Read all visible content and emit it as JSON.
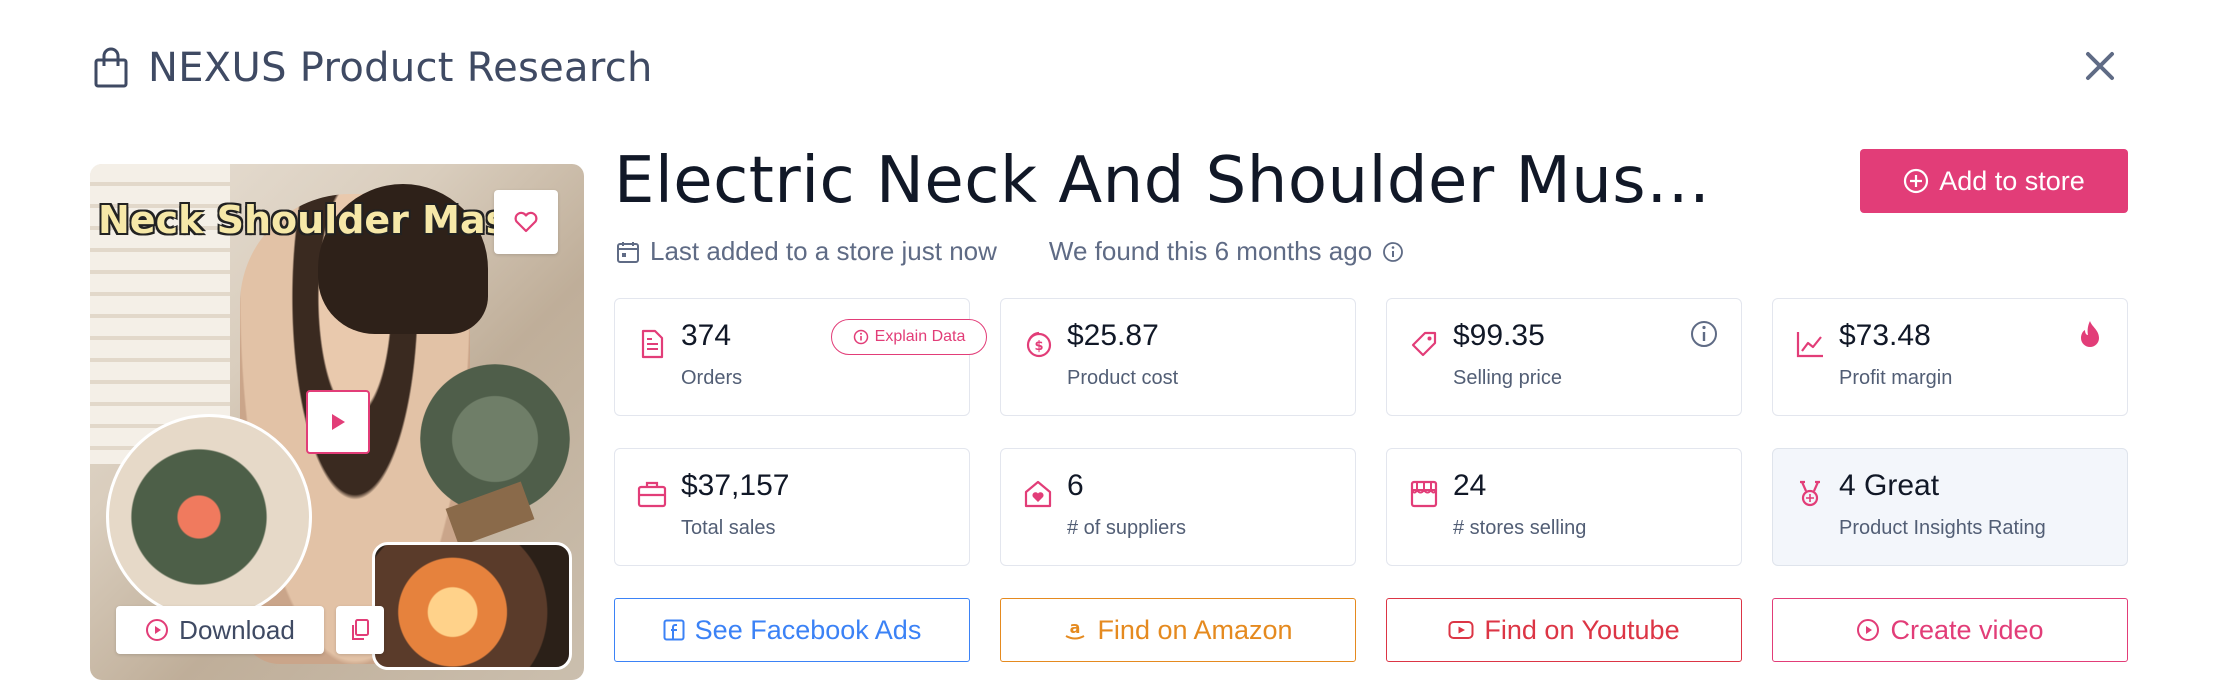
{
  "header": {
    "title": "NEXUS Product Research"
  },
  "image": {
    "banner_text": "Neck Shoulder Massa",
    "download_label": "Download"
  },
  "product": {
    "title": "Electric Neck And Shoulder Muscle M…",
    "last_added": "Last added to a store just now",
    "found": "We found this 6 months ago"
  },
  "add_to_store_label": "Add to store",
  "explain_label": "Explain Data",
  "stats": [
    {
      "value": "374",
      "label": "Orders"
    },
    {
      "value": "$25.87",
      "label": "Product cost"
    },
    {
      "value": "$99.35",
      "label": "Selling price"
    },
    {
      "value": "$73.48",
      "label": "Profit margin"
    },
    {
      "value": "$37,157",
      "label": "Total sales"
    },
    {
      "value": "6",
      "label": "# of suppliers"
    },
    {
      "value": "24",
      "label": "# stores selling"
    },
    {
      "value": "4 Great",
      "label": "Product Insights Rating"
    }
  ],
  "actions": {
    "facebook": "See Facebook Ads",
    "amazon": "Find on Amazon",
    "youtube": "Find on Youtube",
    "video": "Create video"
  },
  "colors": {
    "accent": "#e23d78",
    "facebook": "#3b82f6",
    "amazon": "#e58a1f",
    "youtube": "#dc3545",
    "text": "#3f4a63"
  }
}
